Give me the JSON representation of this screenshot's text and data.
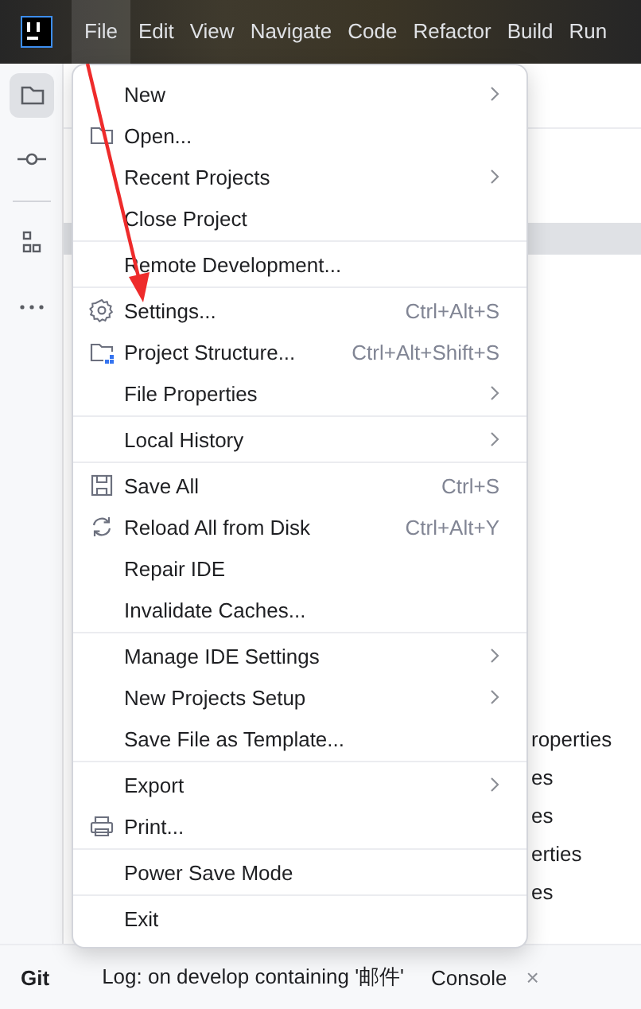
{
  "menu_bar": [
    {
      "label": "File",
      "selected": true
    },
    {
      "label": "Edit",
      "selected": false
    },
    {
      "label": "View",
      "selected": false
    },
    {
      "label": "Navigate",
      "selected": false
    },
    {
      "label": "Code",
      "selected": false
    },
    {
      "label": "Refactor",
      "selected": false
    },
    {
      "label": "Build",
      "selected": false
    },
    {
      "label": "Run",
      "selected": false
    }
  ],
  "file_menu": [
    [
      {
        "label": "New",
        "submenu": true
      },
      {
        "label": "Open...",
        "kind": "folder"
      },
      {
        "label": "Recent Projects",
        "submenu": true
      },
      {
        "label": "Close Project"
      }
    ],
    [
      {
        "label": "Remote Development..."
      }
    ],
    [
      {
        "label": "Settings...",
        "kind": "gear",
        "shortcut": "Ctrl+Alt+S"
      },
      {
        "label": "Project Structure...",
        "kind": "folder-grid",
        "shortcut": "Ctrl+Alt+Shift+S"
      },
      {
        "label": "File Properties",
        "submenu": true
      }
    ],
    [
      {
        "label": "Local History",
        "submenu": true
      }
    ],
    [
      {
        "label": "Save All",
        "kind": "save",
        "shortcut": "Ctrl+S"
      },
      {
        "label": "Reload All from Disk",
        "kind": "reload",
        "shortcut": "Ctrl+Alt+Y"
      },
      {
        "label": "Repair IDE"
      },
      {
        "label": "Invalidate Caches..."
      }
    ],
    [
      {
        "label": "Manage IDE Settings",
        "submenu": true
      },
      {
        "label": "New Projects Setup",
        "submenu": true
      },
      {
        "label": "Save File as Template..."
      }
    ],
    [
      {
        "label": "Export",
        "submenu": true
      },
      {
        "label": "Print...",
        "kind": "print"
      }
    ],
    [
      {
        "label": "Power Save Mode"
      }
    ],
    [
      {
        "label": "Exit"
      }
    ]
  ],
  "background_list": [
    "roperties",
    "es",
    "es",
    "erties",
    "es"
  ],
  "bottom_bar": {
    "title": "Git",
    "tab": "Log: on develop containing '邮件'",
    "console": "Console",
    "close": "×"
  }
}
